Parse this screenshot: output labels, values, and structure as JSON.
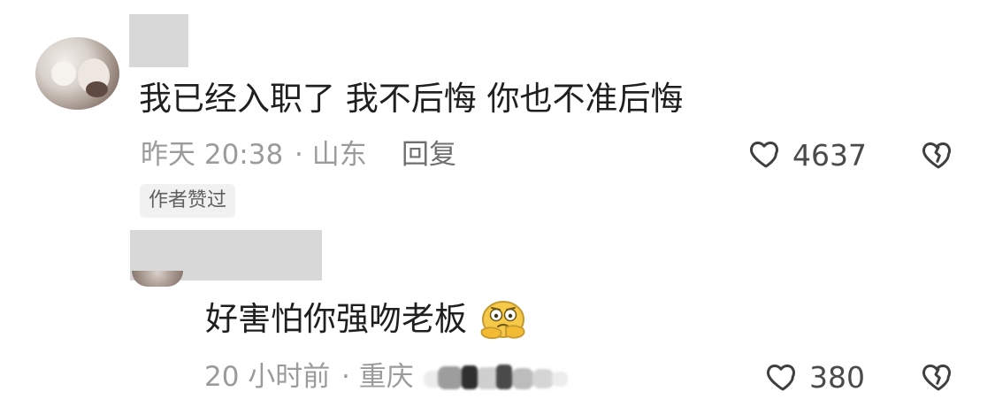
{
  "comments": [
    {
      "text": "我已经入职了 我不后悔 你也不准后悔",
      "time": "昨天 20:38",
      "location": "· 山东",
      "reply_label": "回复",
      "badge": "作者赞过",
      "like_count": "4637"
    },
    {
      "text": "好害怕你强吻老板",
      "time": "20 小时前",
      "location": "· 重庆",
      "like_count": "380"
    }
  ],
  "icons": {
    "like": "heart-outline-icon",
    "dislike": "broken-heart-icon",
    "emoji": "thinking-face-icon"
  },
  "colors": {
    "text": "#1f1f1f",
    "meta": "#9b9b9b",
    "reply": "#6f6f6f",
    "badge_bg": "#f1f1f1",
    "icon": "#3f3f3f"
  }
}
